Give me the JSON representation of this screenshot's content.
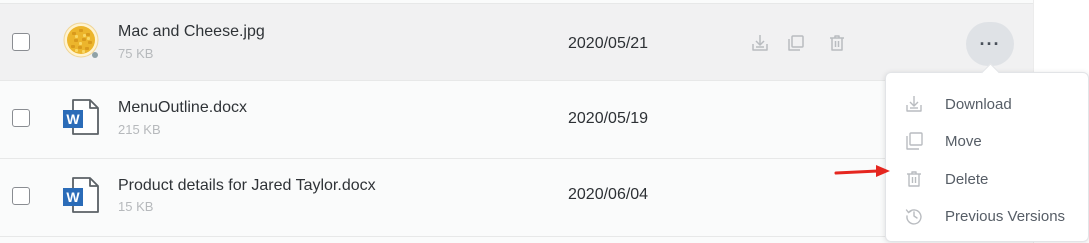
{
  "files": [
    {
      "name": "Mac and Cheese.jpg",
      "size": "75 KB",
      "date": "2020/05/21",
      "icon": "image-thumbnail-icon",
      "selected": true
    },
    {
      "name": "MenuOutline.docx",
      "size": "215 KB",
      "date": "2020/05/19",
      "icon": "word-document-icon",
      "selected": false
    },
    {
      "name": "Product details for Jared Taylor.docx",
      "size": "15 KB",
      "date": "2020/06/04",
      "icon": "word-document-icon",
      "selected": false
    }
  ],
  "row_actions": {
    "download_icon": "download-icon",
    "move_icon": "copy-move-icon",
    "delete_icon": "trash-icon",
    "more_label": "···"
  },
  "menu": {
    "items": [
      {
        "label": "Download",
        "icon": "download-icon"
      },
      {
        "label": "Move",
        "icon": "copy-move-icon"
      },
      {
        "label": "Delete",
        "icon": "trash-icon"
      },
      {
        "label": "Previous Versions",
        "icon": "history-icon"
      }
    ]
  },
  "colors": {
    "selected_row": "#f1f1f2",
    "icon_gray": "#b9bcc0",
    "word_blue": "#2b6cb8",
    "annotation_red": "#e5261f"
  }
}
